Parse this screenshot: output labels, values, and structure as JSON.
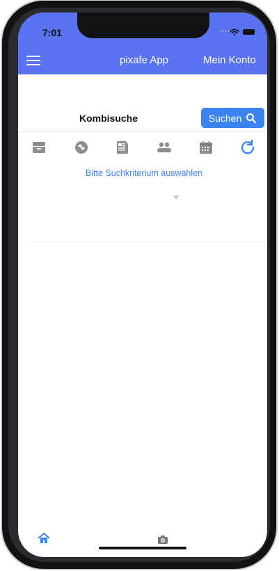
{
  "status_bar": {
    "time": "7:01",
    "signal_text": "...."
  },
  "header": {
    "app_title": "pixafe App",
    "account_label": "Mein Konto"
  },
  "search": {
    "title": "Kombisuche",
    "button_label": "Suchen",
    "hint": "Bitte Suchkriterium auswählen"
  },
  "filter_icons": [
    "archive-box-icon",
    "globe-icon",
    "newspaper-icon",
    "people-icon",
    "calendar-icon",
    "refresh-icon"
  ],
  "bottom_nav": {
    "items": [
      "home-icon",
      "camera-icon"
    ]
  },
  "colors": {
    "header_bg": "#5a73f2",
    "accent": "#3d83ef",
    "icon_gray": "#8d8d8d",
    "text_dark": "#111111"
  }
}
